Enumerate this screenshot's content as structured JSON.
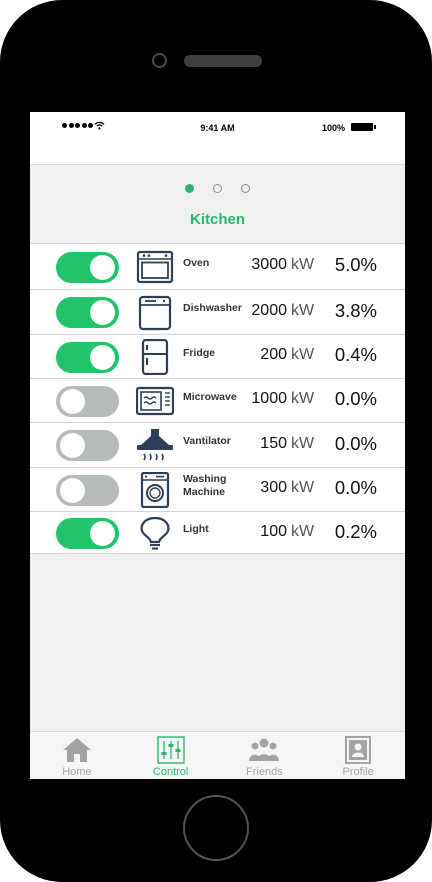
{
  "status_bar": {
    "time": "9:41 AM",
    "battery": "100%"
  },
  "pager": {
    "pages": 3,
    "active_index": 0
  },
  "room": {
    "title": "Kitchen"
  },
  "devices": [
    {
      "name": "Oven",
      "power": "3000",
      "unit": "kW",
      "share": "5.0%",
      "on": true,
      "icon": "oven-icon"
    },
    {
      "name": "Dishwasher",
      "power": "2000",
      "unit": "kW",
      "share": "3.8%",
      "on": true,
      "icon": "dishwasher-icon"
    },
    {
      "name": "Fridge",
      "power": "200",
      "unit": "kW",
      "share": "0.4%",
      "on": true,
      "icon": "fridge-icon"
    },
    {
      "name": "Microwave",
      "power": "1000",
      "unit": "kW",
      "share": "0.0%",
      "on": false,
      "icon": "microwave-icon"
    },
    {
      "name": "Vantilator",
      "power": "150",
      "unit": "kW",
      "share": "0.0%",
      "on": false,
      "icon": "ventilator-icon"
    },
    {
      "name": "Washing\nMachine",
      "power": "300",
      "unit": "kW",
      "share": "0.0%",
      "on": false,
      "icon": "washing-machine-icon"
    },
    {
      "name": "Light",
      "power": "100",
      "unit": "kW",
      "share": "0.2%",
      "on": true,
      "icon": "light-bulb-icon"
    }
  ],
  "tabs": [
    {
      "label": "Home",
      "icon": "home-icon",
      "active": false
    },
    {
      "label": "Control",
      "icon": "sliders-icon",
      "active": true
    },
    {
      "label": "Friends",
      "icon": "friends-icon",
      "active": false
    },
    {
      "label": "Profile",
      "icon": "profile-icon",
      "active": false
    }
  ],
  "colors": {
    "accent": "#2cb56e",
    "toggle_on": "#22c46a",
    "toggle_off": "#b5bbba",
    "icon_stroke": "#2c3e58",
    "tab_inactive": "#a3a3a3"
  }
}
